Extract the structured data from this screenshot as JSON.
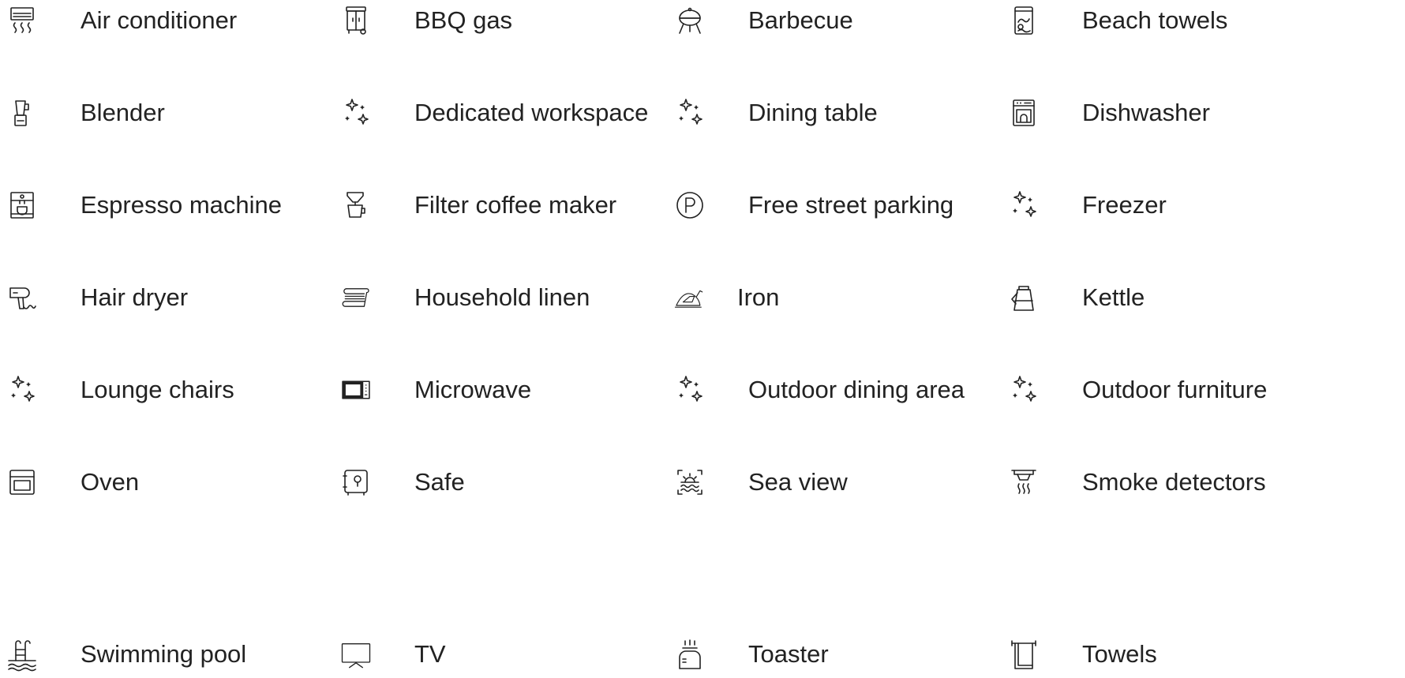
{
  "amenities": [
    {
      "label": "Air conditioner",
      "icon": "air-conditioner-icon"
    },
    {
      "label": "BBQ gas",
      "icon": "bbq-gas-icon"
    },
    {
      "label": "Barbecue",
      "icon": "barbecue-icon"
    },
    {
      "label": "Beach towels",
      "icon": "beach-towels-icon"
    },
    {
      "label": "Blender",
      "icon": "blender-icon"
    },
    {
      "label": "Dedicated workspace",
      "icon": "sparkles-icon"
    },
    {
      "label": "Dining table",
      "icon": "sparkles-icon"
    },
    {
      "label": "Dishwasher",
      "icon": "dishwasher-icon"
    },
    {
      "label": "Espresso machine",
      "icon": "espresso-machine-icon"
    },
    {
      "label": "Filter coffee maker",
      "icon": "filter-coffee-maker-icon"
    },
    {
      "label": "Free street parking",
      "icon": "parking-icon"
    },
    {
      "label": "Freezer",
      "icon": "sparkles-icon"
    },
    {
      "label": "Hair dryer",
      "icon": "hair-dryer-icon"
    },
    {
      "label": "Household linen",
      "icon": "household-linen-icon"
    },
    {
      "label": "Iron",
      "icon": "iron-icon"
    },
    {
      "label": "Kettle",
      "icon": "kettle-icon"
    },
    {
      "label": "Lounge chairs",
      "icon": "sparkles-icon"
    },
    {
      "label": "Microwave",
      "icon": "microwave-icon"
    },
    {
      "label": "Outdoor dining area",
      "icon": "sparkles-icon"
    },
    {
      "label": "Outdoor furniture",
      "icon": "sparkles-icon"
    },
    {
      "label": "Oven",
      "icon": "oven-icon"
    },
    {
      "label": "Safe",
      "icon": "safe-icon"
    },
    {
      "label": "Sea view",
      "icon": "sea-view-icon"
    },
    {
      "label": "Smoke detectors",
      "icon": "smoke-detector-icon"
    },
    {
      "label": "Swimming pool",
      "icon": "swimming-pool-icon"
    },
    {
      "label": "TV",
      "icon": "tv-icon"
    },
    {
      "label": "Toaster",
      "icon": "toaster-icon"
    },
    {
      "label": "Towels",
      "icon": "towels-icon"
    }
  ],
  "colors": {
    "text": "#222222",
    "background": "#ffffff"
  }
}
